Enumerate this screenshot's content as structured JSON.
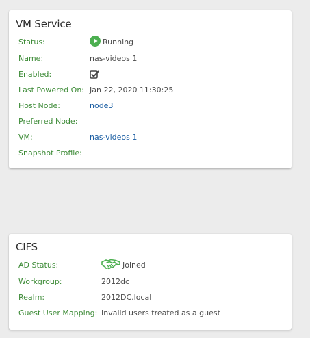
{
  "vm_service": {
    "title": "VM Service",
    "status": {
      "label": "Status:",
      "value": "Running",
      "icon": "play-circle-icon",
      "icon_color": "#4caf50"
    },
    "name": {
      "label": "Name:",
      "value": "nas-videos 1"
    },
    "enabled": {
      "label": "Enabled:",
      "icon": "checked-checkbox-icon",
      "checked": true
    },
    "last_powered_on": {
      "label": "Last Powered On:",
      "value": "Jan 22, 2020 11:30:25"
    },
    "host_node": {
      "label": "Host Node:",
      "value": "node3"
    },
    "preferred_node": {
      "label": "Preferred Node:",
      "value": ""
    },
    "vm": {
      "label": "VM:",
      "value": "nas-videos 1"
    },
    "snapshot_profile": {
      "label": "Snapshot Profile:",
      "value": ""
    }
  },
  "cifs": {
    "title": "CIFS",
    "ad_status": {
      "label": "AD Status:",
      "value": "Joined",
      "icon": "handshake-icon",
      "icon_color": "#4caf50"
    },
    "workgroup": {
      "label": "Workgroup:",
      "value": "2012dc"
    },
    "realm": {
      "label": "Realm:",
      "value": "2012DC.local"
    },
    "guest_user_mapping": {
      "label": "Guest User Mapping:",
      "value": "Invalid users treated as a guest"
    }
  },
  "colors": {
    "label_green": "#3d8b37",
    "link_blue": "#1b5ea3",
    "background": "#ececec"
  }
}
